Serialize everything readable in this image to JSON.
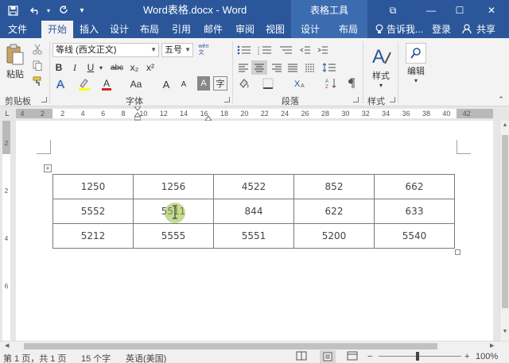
{
  "titlebar": {
    "title": "Word表格.docx - Word",
    "contextual_tool": "表格工具",
    "restore_glyph": "⧉",
    "minimize_glyph": "—",
    "maximize_glyph": "☐",
    "close_glyph": "✕"
  },
  "tabs": {
    "file": "文件",
    "home": "开始",
    "insert": "插入",
    "design": "设计",
    "layout": "布局",
    "references": "引用",
    "mailings": "邮件",
    "review": "审阅",
    "view": "视图",
    "table_design": "设计",
    "table_layout": "布局",
    "tell_me": "告诉我...",
    "signin": "登录",
    "share": "共享"
  },
  "ribbon": {
    "clipboard": {
      "paste_label": "粘贴",
      "group_label": "剪贴板"
    },
    "font": {
      "font_name": "等线 (西文正文)",
      "font_size": "五号",
      "grow_label": "A",
      "shrink_label": "A",
      "bold": "B",
      "italic": "I",
      "underline": "U",
      "strikethrough": "abc",
      "subscript": "x₂",
      "superscript": "x²",
      "case_label": "Aa",
      "clear_label": "A",
      "group_label": "字体",
      "wen_label": "wén\n文"
    },
    "paragraph": {
      "group_label": "段落"
    },
    "styles": {
      "label": "样式",
      "group_label": "样式"
    },
    "editing": {
      "label": "编辑"
    }
  },
  "ruler": {
    "corner": "L",
    "ticks": [
      "4",
      "2",
      "2",
      "4",
      "6",
      "8",
      "10",
      "12",
      "14",
      "16",
      "18",
      "20",
      "22",
      "24",
      "26",
      "28",
      "30",
      "32",
      "34",
      "36",
      "38",
      "40",
      "42"
    ]
  },
  "vruler": {
    "ticks": [
      "2",
      "2",
      "4",
      "6"
    ]
  },
  "table": {
    "rows": [
      [
        "1250",
        "1256",
        "4522",
        "852",
        "662"
      ],
      [
        "5552",
        "5511",
        "844",
        "622",
        "633"
      ],
      [
        "5212",
        "5555",
        "5551",
        "5200",
        "5540"
      ]
    ]
  },
  "statusbar": {
    "page": "第 1 页，共 1 页",
    "words": "15 个字",
    "language": "英语(美国)",
    "zoom": "100%",
    "zoom_out": "−",
    "zoom_in": "+"
  },
  "colors": {
    "title_bar": "#2b579a",
    "contextual_tab": "#3c6cb0",
    "ribbon_bg": "#f3f3f3",
    "cursor_highlight": "#96be3c"
  }
}
